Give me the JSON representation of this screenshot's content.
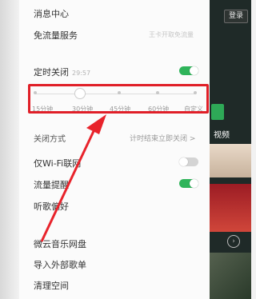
{
  "menu": {
    "messages": "消息中心",
    "free_data": "免流量服务",
    "free_data_hint": "王卡开取免流量",
    "timer_label": "定时关闭",
    "timer_time": "29:57",
    "timer_on": true,
    "slider": {
      "ticks": [
        "15分钟",
        "30分钟",
        "45分钟",
        "60分钟",
        "自定义"
      ],
      "selected_index": 1
    },
    "close_mode_label": "关闭方式",
    "close_mode_value": "计时结束立即关闭 >",
    "wifi_only": "仅Wi-Fi联网",
    "wifi_only_on": false,
    "data_alert": "流量提醒",
    "data_alert_on": true,
    "music_pref": "听歌偏好",
    "cloud_disk": "微云音乐网盘",
    "import_songs": "导入外部歌单",
    "clean_space": "清理空间"
  },
  "background": {
    "badge": "登录",
    "video_label": "视频",
    "chevron": "›"
  },
  "colors": {
    "accent_green": "#2fb45a",
    "highlight_red": "#e01f28",
    "arrow_red": "#e8232b"
  }
}
